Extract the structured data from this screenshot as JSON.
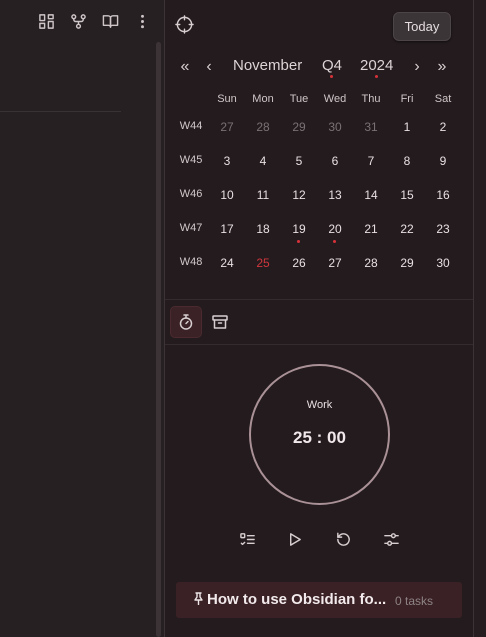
{
  "left_toolbar": {
    "icons": [
      "grid-icon",
      "git-fork-icon",
      "book-open-icon",
      "more-vertical-icon"
    ]
  },
  "calendar": {
    "today_label": "Today",
    "nav": {
      "first": "«",
      "prev": "‹",
      "month": "November",
      "quarter": "Q4",
      "year": "2024",
      "next": "›",
      "last": "»"
    },
    "weekdays": [
      "Sun",
      "Mon",
      "Tue",
      "Wed",
      "Thu",
      "Fri",
      "Sat"
    ],
    "weeks": [
      {
        "label": "W44",
        "days": [
          "27",
          "28",
          "29",
          "30",
          "31",
          "1",
          "2"
        ]
      },
      {
        "label": "W45",
        "days": [
          "3",
          "4",
          "5",
          "6",
          "7",
          "8",
          "9"
        ]
      },
      {
        "label": "W46",
        "days": [
          "10",
          "11",
          "12",
          "13",
          "14",
          "15",
          "16"
        ]
      },
      {
        "label": "W47",
        "days": [
          "17",
          "18",
          "19",
          "20",
          "21",
          "22",
          "23"
        ]
      },
      {
        "label": "W48",
        "days": [
          "24",
          "25",
          "26",
          "27",
          "28",
          "29",
          "30"
        ]
      }
    ],
    "today_date": "25",
    "dots_on": [
      "19",
      "20"
    ],
    "accent_color": "#d7323a"
  },
  "tabs": {
    "items": [
      "timer-icon",
      "archive-icon"
    ],
    "active": "timer-icon"
  },
  "timer": {
    "label": "Work",
    "time": "25 : 00",
    "ring_color": "#a99197"
  },
  "controls": [
    "task-list-icon",
    "play-icon",
    "reset-icon",
    "settings-sliders-icon"
  ],
  "task": {
    "title": "How to use Obsidian fo...",
    "count": "0 tasks"
  }
}
